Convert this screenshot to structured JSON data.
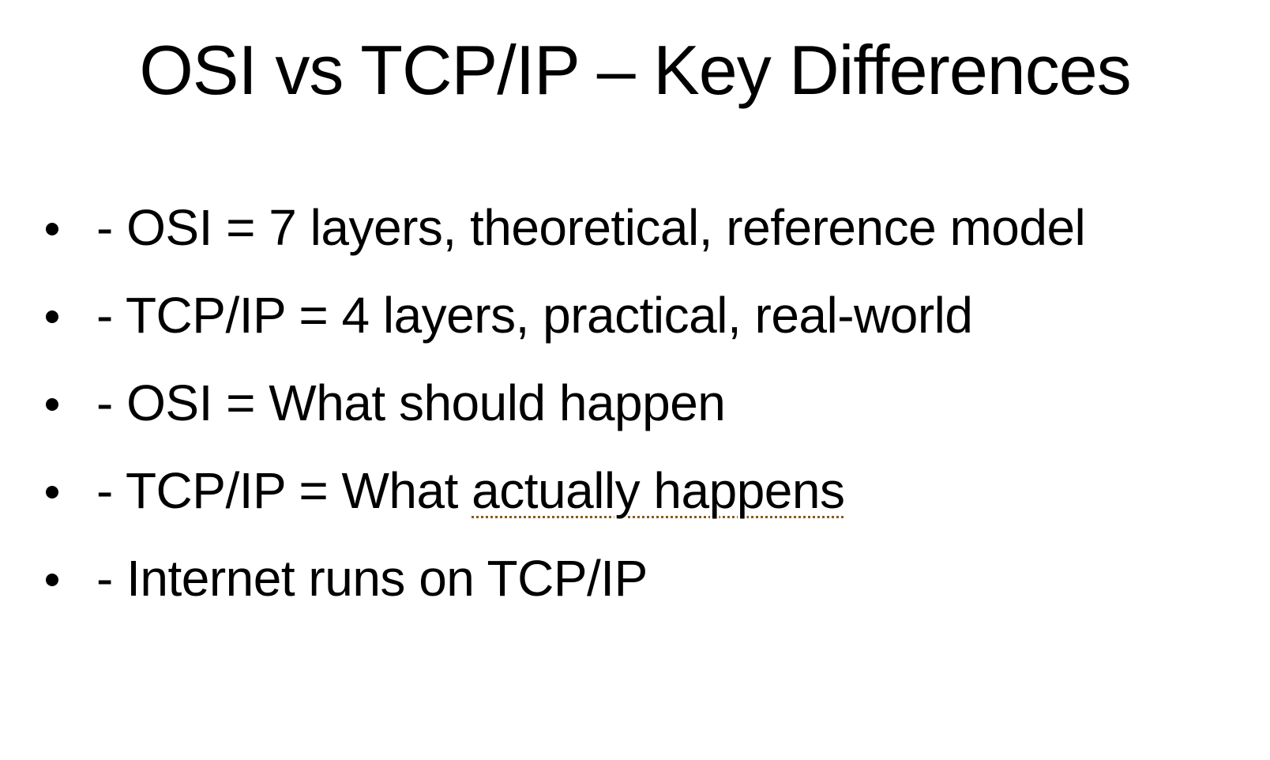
{
  "slide": {
    "title": "OSI vs TCP/IP – Key Differences",
    "bullets": [
      {
        "text": "- OSI = 7 layers, theoretical, reference model"
      },
      {
        "text": "- TCP/IP = 4 layers, practical, real-world"
      },
      {
        "text": "- OSI = What should happen"
      },
      {
        "text_before": "- TCP/IP = What ",
        "text_flagged": "actually happens"
      },
      {
        "text": "- Internet runs on TCP/IP"
      }
    ]
  },
  "colors": {
    "background": "#ffffff",
    "text": "#000000",
    "proofing_underline": "#8a5a1a"
  }
}
